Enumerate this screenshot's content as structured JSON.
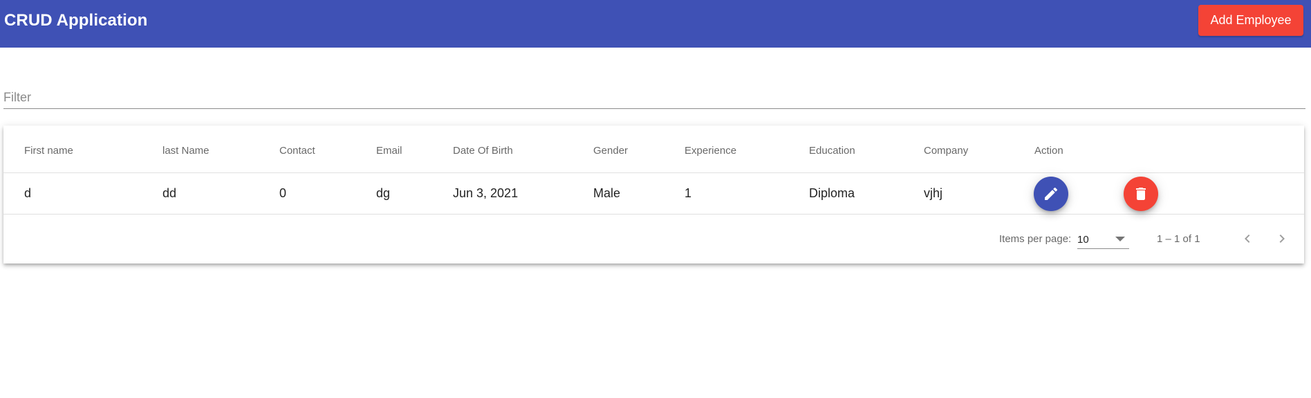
{
  "header": {
    "title": "CRUD Application",
    "add_button_label": "Add Employee"
  },
  "filter": {
    "placeholder": "Filter",
    "value": ""
  },
  "table": {
    "columns": [
      "First name",
      "last Name",
      "Contact",
      "Email",
      "Date Of Birth",
      "Gender",
      "Experience",
      "Education",
      "Company",
      "Action"
    ],
    "rows": [
      {
        "first_name": "d",
        "last_name": "dd",
        "contact": "0",
        "email": "dg",
        "dob": "Jun 3, 2021",
        "gender": "Male",
        "experience": "1",
        "education": "Diploma",
        "company": "vjhj"
      }
    ]
  },
  "paginator": {
    "items_per_page_label": "Items per page:",
    "page_size": "10",
    "range_label": "1 – 1 of 1"
  },
  "icons": {
    "edit": "pencil-icon",
    "delete": "trash-icon",
    "dropdown": "caret-down-icon",
    "prev": "chevron-left-icon",
    "next": "chevron-right-icon"
  },
  "colors": {
    "primary": "#3f51b5",
    "warn": "#f44336"
  }
}
